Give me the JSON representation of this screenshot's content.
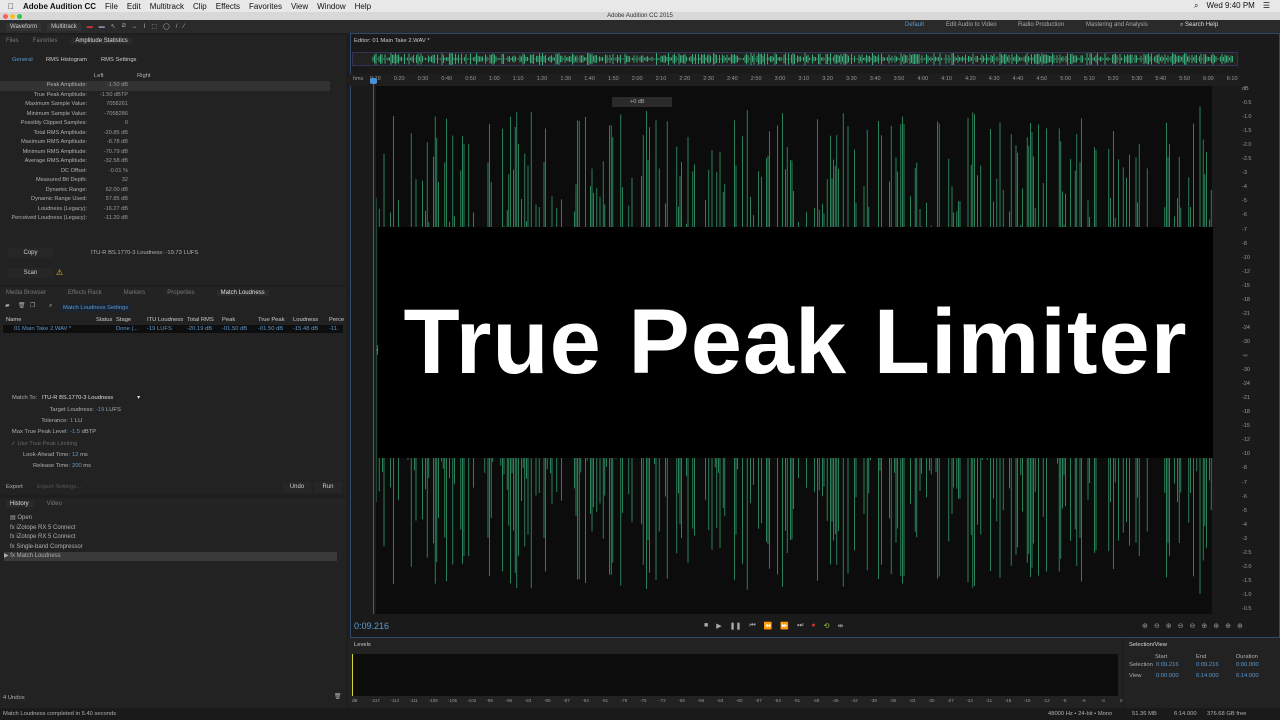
{
  "menubar": {
    "app": "Adobe Audition CC",
    "items": [
      "File",
      "Edit",
      "Multitrack",
      "Clip",
      "Effects",
      "Favorites",
      "View",
      "Window",
      "Help"
    ],
    "clock": "Wed 9:40 PM"
  },
  "window_title": "Adobe Audition CC 2015",
  "toolbar": {
    "waveform": "Waveform",
    "multitrack": "Multitrack"
  },
  "workspaces": {
    "default": "Default",
    "items": [
      "Edit Audio to Video",
      "Radio Production",
      "Mastering and Analysis"
    ],
    "search": "Search Help"
  },
  "stats_panel": {
    "tabs": [
      "Files",
      "Favorites",
      "Amplitude Statistics"
    ],
    "subtabs": [
      "General",
      "RMS Histogram",
      "RMS Settings"
    ],
    "col_left": "Left",
    "col_right": "Right",
    "rows": [
      [
        "Peak Amplitude:",
        "-1.50 dB"
      ],
      [
        "True Peak Amplitude:",
        "-1.50 dBTP"
      ],
      [
        "Maximum Sample Value:",
        "7058261"
      ],
      [
        "Minimum Sample Value:",
        "-7058286"
      ],
      [
        "Possibly Clipped Samples:",
        "0"
      ],
      [
        "Total RMS Amplitude:",
        "-20.85 dB"
      ],
      [
        "Maximum RMS Amplitude:",
        "-8.78 dB"
      ],
      [
        "Minimum RMS Amplitude:",
        "-70.79 dB"
      ],
      [
        "Average RMS Amplitude:",
        "-32.58 dB"
      ],
      [
        "DC Offset:",
        "-0.01 %"
      ],
      [
        "Measured Bit Depth:",
        "32"
      ],
      [
        "Dynamic Range:",
        "62.00 dB"
      ],
      [
        "Dynamic Range Used:",
        "57.85 dB"
      ],
      [
        "Loudness (Legacy):",
        "-16.27 dB"
      ],
      [
        "Perceived Loudness (Legacy):",
        "-11.20 dB"
      ]
    ],
    "copy": "Copy",
    "itu": "ITU-R BS.1770-3 Loudness: -19.73 LUFS",
    "scan": "Scan"
  },
  "ml_panel": {
    "tabs": [
      "Media Browser",
      "Effects Rack",
      "Markers",
      "Properties",
      "Match Loudness"
    ],
    "settings_btn": "Match Loudness Settings",
    "columns": [
      "Name",
      "Status",
      "Stage",
      "ITU Loudness",
      "Total RMS",
      "Peak",
      "True Peak",
      "Loudness",
      "Perce"
    ],
    "row": [
      "01 Main Take 2.WAV *",
      "",
      "Done (...",
      "-19 LUFS",
      "-20.19 dB",
      "-01.50 dB",
      "-01.50 dB",
      "-15.48 dB",
      "-11."
    ],
    "match_to_label": "Match To:",
    "match_to": "ITU-R BS.1770-3 Loudness",
    "settings": [
      [
        "Target Loudness:",
        "-19",
        "LUFS"
      ],
      [
        "Tolerance:",
        "1",
        "LU"
      ],
      [
        "Max True Peak Level:",
        "-1.5",
        "dBTP"
      ]
    ],
    "use_tpl": "Use True Peak Limiting",
    "lookahead": [
      "Look-Ahead Time:",
      "12",
      "ms"
    ],
    "release": [
      "Release Time:",
      "200",
      "ms"
    ],
    "export": "Export",
    "export_settings": "Export Settings...",
    "undo": "Undo",
    "run": "Run"
  },
  "history": {
    "tabs": [
      "History",
      "Video"
    ],
    "items": [
      "Open",
      "iZotope RX 5 Connect",
      "iZotope RX 5 Connect",
      "Single-band Compressor",
      "Match Loudness"
    ],
    "undos": "4 Undos"
  },
  "editor": {
    "tab": "Editor: 01 Main Take 2.WAV *",
    "ruler_unit": "hms",
    "ruler": [
      "0:10",
      "0:20",
      "0:30",
      "0:40",
      "0:50",
      "1:00",
      "1:10",
      "1:20",
      "1:30",
      "1:40",
      "1:50",
      "2:00",
      "2:10",
      "2:20",
      "2:30",
      "2:40",
      "2:50",
      "3:00",
      "3:10",
      "3:20",
      "3:30",
      "3:40",
      "3:50",
      "4:00",
      "4:10",
      "4:20",
      "4:30",
      "4:40",
      "4:50",
      "5:00",
      "5:10",
      "5:20",
      "5:30",
      "5:40",
      "5:50",
      "6:00",
      "6:10"
    ],
    "hud": "+0 dB",
    "db_scale": [
      "dB",
      "-0.5",
      "-1.0",
      "-1.5",
      "-2.0",
      "-2.5",
      "-3",
      "-4",
      "-5",
      "-6",
      "-7",
      "-8",
      "-10",
      "-12",
      "-15",
      "-18",
      "-21",
      "-24",
      "-30",
      "-∞",
      "-30",
      "-24",
      "-21",
      "-18",
      "-15",
      "-12",
      "-10",
      "-8",
      "-7",
      "-6",
      "-5",
      "-4",
      "-3",
      "-2.5",
      "-2.0",
      "-1.5",
      "-1.0",
      "-0.5"
    ],
    "overlay": "True Peak Limiter",
    "time": "0:09.216",
    "colors": {
      "wave": "#3ecf8e",
      "time": "#5d9ad0"
    }
  },
  "levels": {
    "title": "Levels",
    "ticks": [
      "dB",
      "-117",
      "-114",
      "-111",
      "-108",
      "-105",
      "-102",
      "-99",
      "-96",
      "-93",
      "-90",
      "-87",
      "-84",
      "-81",
      "-78",
      "-75",
      "-72",
      "-69",
      "-66",
      "-63",
      "-60",
      "-57",
      "-54",
      "-51",
      "-48",
      "-45",
      "-42",
      "-39",
      "-36",
      "-33",
      "-30",
      "-27",
      "-24",
      "-21",
      "-18",
      "-15",
      "-12",
      "-9",
      "-6",
      "-3",
      "0"
    ]
  },
  "selection": {
    "title": "Selection/View",
    "headers": [
      "Start",
      "End",
      "Duration"
    ],
    "selection": [
      "Selection",
      "0:09.216",
      "0:09.216",
      "0:00.000"
    ],
    "view": [
      "View",
      "0:00.000",
      "6:14.000",
      "6:14.000"
    ]
  },
  "status": {
    "left": "Match Loudness completed in 5.40 seconds",
    "format": "48000 Hz • 24-bit • Mono",
    "size": "51.36 MB",
    "duration": "6:14.000",
    "free": "376.68 GB free"
  }
}
